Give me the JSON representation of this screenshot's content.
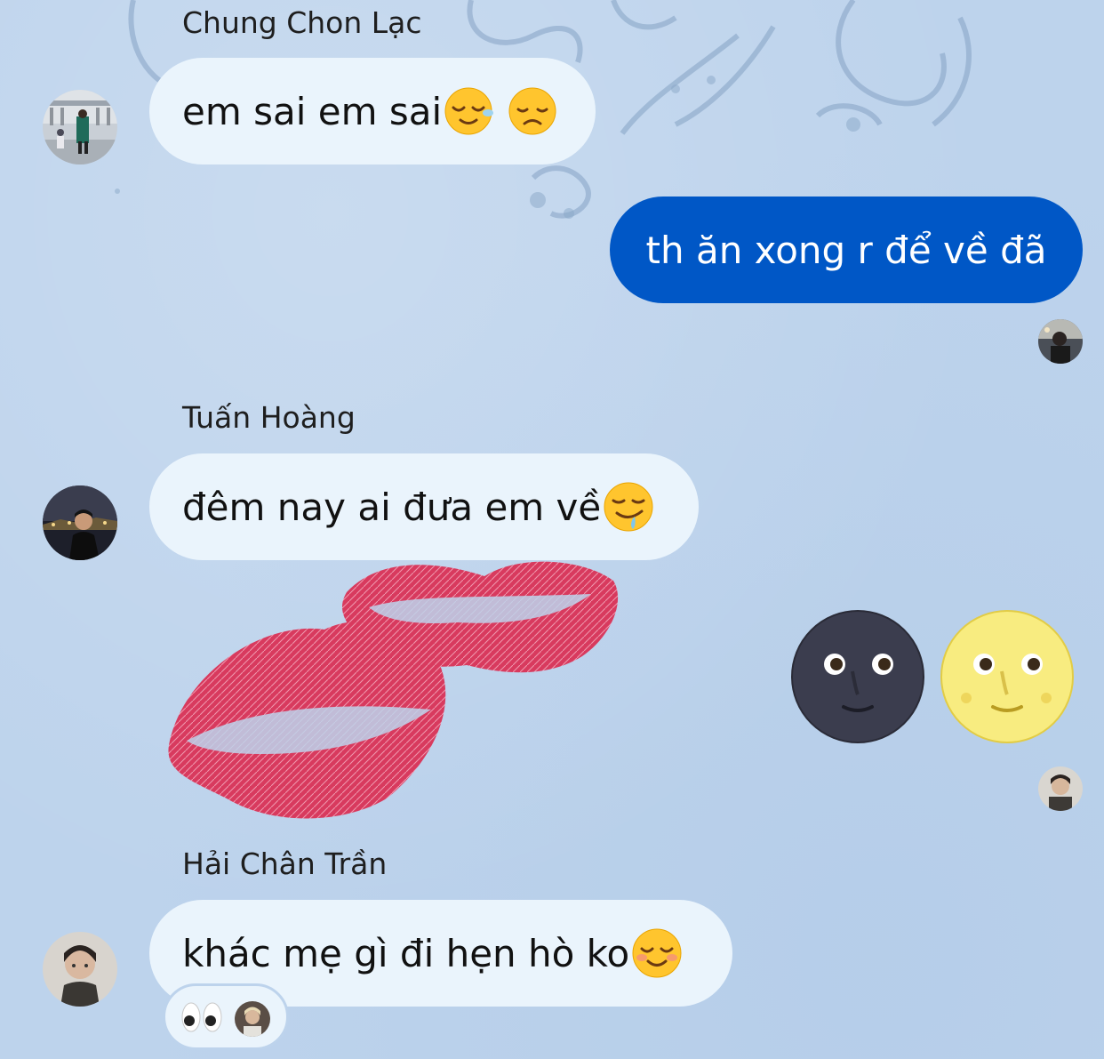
{
  "messages": [
    {
      "sender": "Chung Chon Lạc",
      "text": "em sai em sai",
      "emojis": [
        "relieved-face",
        "disappointed-face"
      ]
    },
    {
      "sender": "",
      "text": "th ăn xong r để về đã",
      "direction": "outgoing"
    },
    {
      "sender": "Tuấn Hoàng",
      "text": "đêm nay ai đưa em về",
      "emojis": [
        "drooling-face"
      ]
    },
    {
      "sender": "",
      "sticker": "lipstick-kiss",
      "direction": "incoming"
    },
    {
      "sender": "",
      "emojis": [
        "new-moon-face",
        "full-moon-face"
      ],
      "direction": "outgoing"
    },
    {
      "sender": "Hải Chân Trần",
      "text": "khác mẹ gì đi hẹn hò ko",
      "emojis": [
        "smiling-face"
      ],
      "reactions": [
        "eyes"
      ]
    }
  ],
  "colors": {
    "background": "#bdd3ec",
    "incoming_bubble": "#eaf4fc",
    "outgoing_bubble": "#0057c6",
    "lipstick": "#d83a5e"
  }
}
